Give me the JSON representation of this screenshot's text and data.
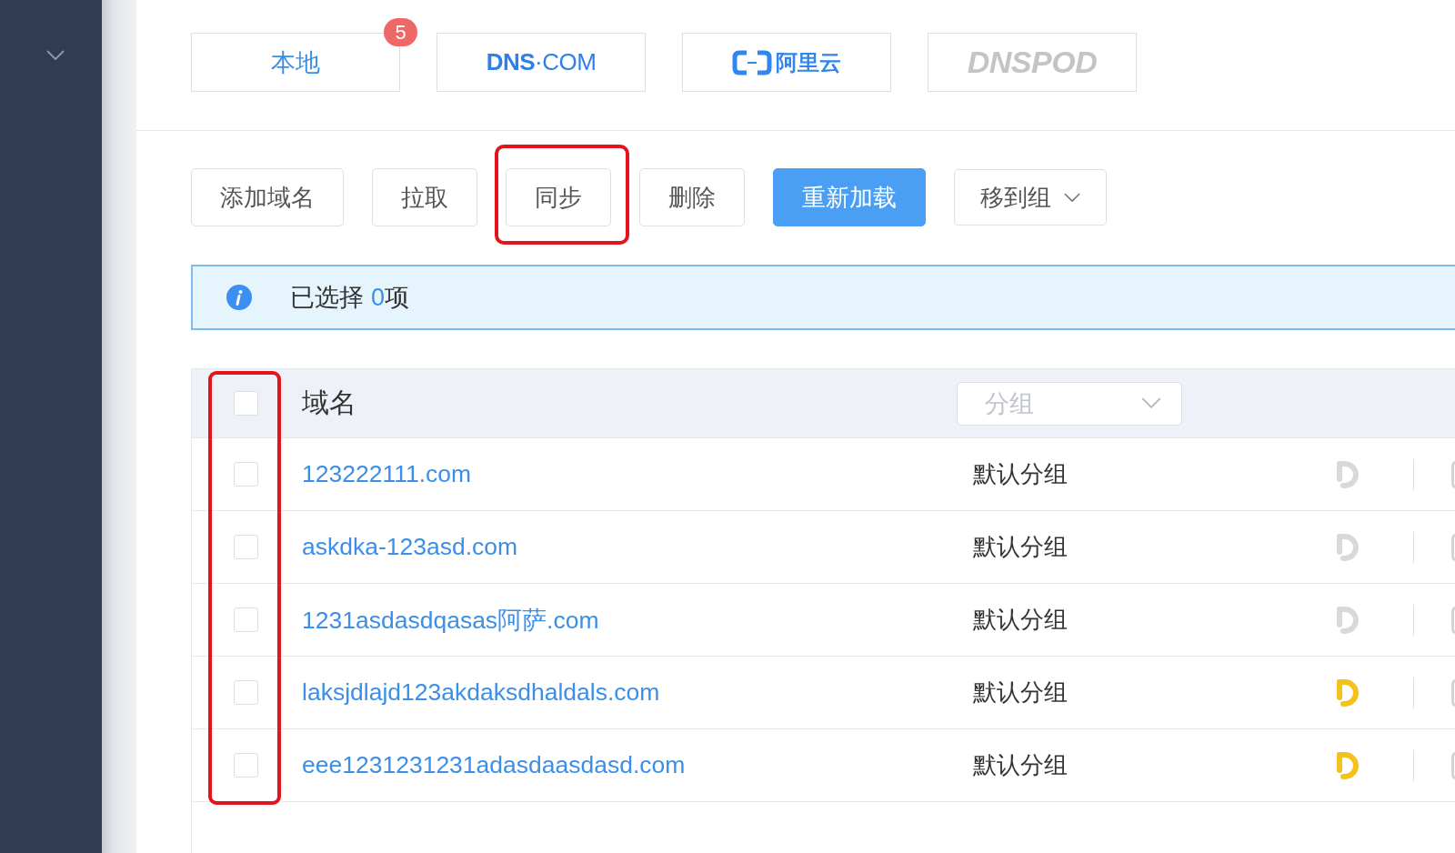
{
  "providers": [
    {
      "kind": "text",
      "label": "本地",
      "badge": "5",
      "disabled": false
    },
    {
      "kind": "wordmark",
      "label": "**DNS**·COM",
      "disabled": false
    },
    {
      "kind": "icon_wordmark",
      "label": "阿里云",
      "disabled": false
    },
    {
      "kind": "italic_wordmark",
      "label": "DNSPOD",
      "disabled": true
    }
  ],
  "toolbar": [
    {
      "kind": "default",
      "label": "添加域名",
      "highlighted": false
    },
    {
      "kind": "default",
      "label": "拉取",
      "highlighted": false
    },
    {
      "kind": "default",
      "label": "同步",
      "highlighted": true
    },
    {
      "kind": "default",
      "label": "删除",
      "highlighted": false
    },
    {
      "kind": "primary",
      "label": "重新加载",
      "highlighted": false
    },
    {
      "kind": "dropdown",
      "label": "移到组",
      "highlighted": false
    }
  ],
  "selection_alert": {
    "label": "已选择",
    "count": "0",
    "unit": "项"
  },
  "table": {
    "checkbox_column_highlighted": true,
    "header": {
      "checked": false,
      "domain": "域名",
      "group_filter": {
        "placeholder": "分组"
      }
    },
    "rows": [
      {
        "checked": false,
        "domain": "123222111.com",
        "group": "默认分组",
        "dnspod_active": false
      },
      {
        "checked": false,
        "domain": "askdka-123asd.com",
        "group": "默认分组",
        "dnspod_active": false
      },
      {
        "checked": false,
        "domain": "1231asdasdqasas阿萨.com",
        "group": "默认分组",
        "dnspod_active": false
      },
      {
        "checked": false,
        "domain": "laksjdlajd123akdaksdhaldals.com",
        "group": "默认分组",
        "dnspod_active": true
      },
      {
        "checked": false,
        "domain": "eee1231231231adasdaasdasd.com",
        "group": "默认分组",
        "dnspod_active": true
      }
    ]
  }
}
